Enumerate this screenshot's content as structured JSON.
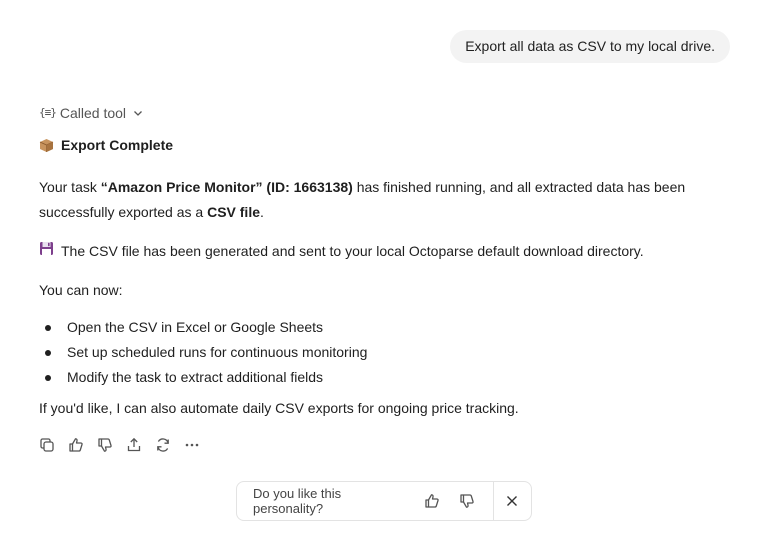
{
  "user_message": "Export all data as CSV to my local drive.",
  "tool_indicator": {
    "label": "Called tool"
  },
  "response": {
    "heading_icon": "package-icon",
    "heading": "Export Complete",
    "p1": {
      "t1": "Your task ",
      "b1": "“Amazon Price Monitor” (ID: 1663138)",
      "t2": " has finished running, and all extracted data has been successfully exported as a ",
      "b2": "CSV file",
      "t3": "."
    },
    "p2_icon": "floppy-disk-icon",
    "p2": "The CSV file has been generated and sent to your local Octoparse default download directory.",
    "p3": "You can now:",
    "bullets": [
      "Open the CSV in Excel or Google Sheets",
      "Set up scheduled runs for continuous monitoring",
      "Modify the task to extract additional fields"
    ],
    "p4": "If you'd like, I can also automate daily CSV exports for ongoing price tracking."
  },
  "actions": [
    "copy-icon",
    "thumbs-up-icon",
    "thumbs-down-icon",
    "share-icon",
    "regenerate-icon",
    "more-icon"
  ],
  "feedback": {
    "question": "Do you like this personality?"
  }
}
